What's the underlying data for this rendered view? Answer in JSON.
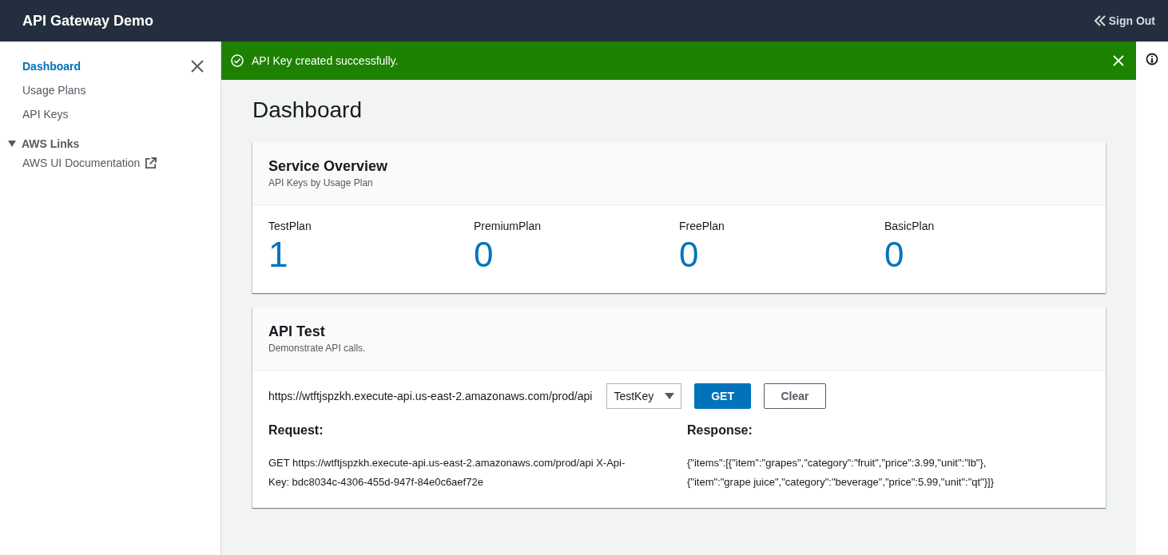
{
  "header": {
    "title": "API Gateway Demo",
    "sign_out": "Sign Out"
  },
  "sidebar": {
    "items": [
      {
        "label": "Dashboard",
        "selected": true
      },
      {
        "label": "Usage Plans",
        "selected": false
      },
      {
        "label": "API Keys",
        "selected": false
      }
    ],
    "section": {
      "label": "AWS Links",
      "expanded": true,
      "links": [
        {
          "label": "AWS UI Documentation",
          "external": true
        }
      ]
    }
  },
  "flash": {
    "message": "API Key created successfully."
  },
  "page_title": "Dashboard",
  "overview": {
    "title": "Service Overview",
    "subtitle": "API Keys by Usage Plan",
    "plans": [
      {
        "name": "TestPlan",
        "count": "1"
      },
      {
        "name": "PremiumPlan",
        "count": "0"
      },
      {
        "name": "FreePlan",
        "count": "0"
      },
      {
        "name": "BasicPlan",
        "count": "0"
      }
    ]
  },
  "api_test": {
    "title": "API Test",
    "subtitle": "Demonstrate API calls.",
    "url": "https://wtftjspzkh.execute-api.us-east-2.amazonaws.com/prod/api",
    "key_select": "TestKey",
    "get_button": "GET",
    "clear_button": "Clear",
    "request_label": "Request:",
    "request": "GET https://wtftjspzkh.execute-api.us-east-2.amazonaws.com/prod/api X-Api-Key: bdc8034c-4306-455d-947f-84e0c6aef72e",
    "response_label": "Response:",
    "response": "{\"items\":[{\"item\":\"grapes\",\"category\":\"fruit\",\"price\":3.99,\"unit\":\"lb\"},{\"item\":\"grape juice\",\"category\":\"beverage\",\"price\":5.99,\"unit\":\"qt\"}]}"
  }
}
